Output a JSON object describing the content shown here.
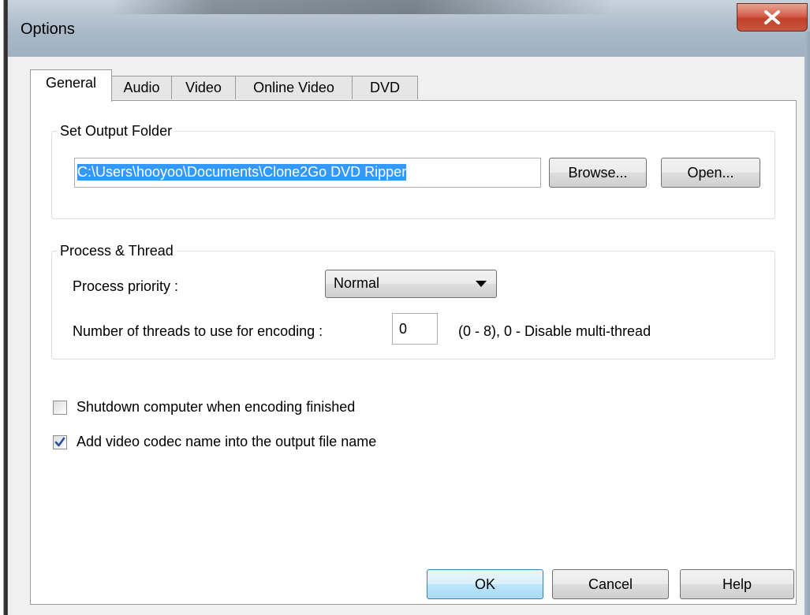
{
  "window": {
    "title": "Options",
    "close_icon": "close-icon"
  },
  "tabs": [
    {
      "label": "General",
      "active": true
    },
    {
      "label": "Audio",
      "active": false
    },
    {
      "label": "Video",
      "active": false
    },
    {
      "label": "Online Video",
      "active": false
    },
    {
      "label": "DVD",
      "active": false
    }
  ],
  "output_folder": {
    "group_label": "Set Output Folder",
    "path_value": "C:\\Users\\hooyoo\\Documents\\Clone2Go DVD Ripper",
    "browse_label": "Browse...",
    "open_label": "Open..."
  },
  "process_thread": {
    "group_label": "Process & Thread",
    "priority_label": "Process priority :",
    "priority_value": "Normal",
    "threads_label": "Number of threads to use for encoding :",
    "threads_value": "0",
    "threads_hint": "(0 - 8), 0 - Disable multi-thread"
  },
  "options": [
    {
      "label": "Shutdown computer when encoding finished",
      "checked": false
    },
    {
      "label": "Add video codec name into the output file name",
      "checked": true
    }
  ],
  "buttons": {
    "ok_label": "OK",
    "cancel_label": "Cancel",
    "help_label": "Help"
  },
  "colors": {
    "close_button": "#c7553f",
    "selection": "#3399ff",
    "check_mark": "#2a4f9e"
  }
}
